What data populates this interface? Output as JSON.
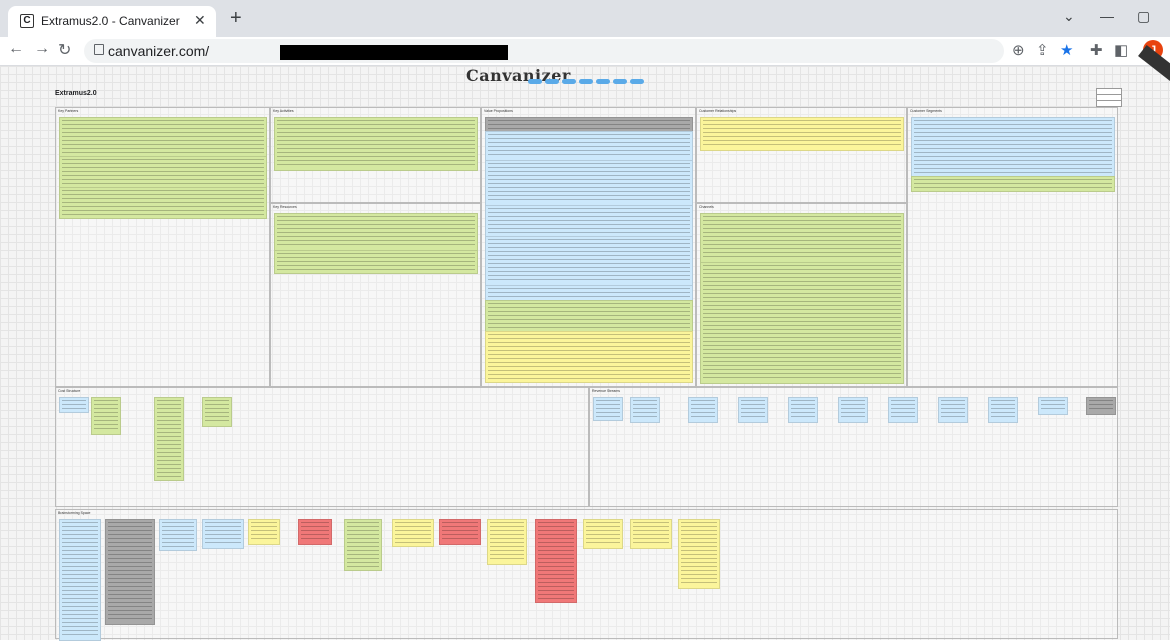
{
  "browser": {
    "tab_title": "Extramus2.0 - Canvanizer",
    "tab_favicon": "C",
    "url": "canvanizer.com/",
    "avatar_letter": "J",
    "accent_color": "#e8430f"
  },
  "canvas": {
    "logo": "Canvanizer",
    "project_title": "Extramus2.0",
    "blocks": [
      "Key Partners",
      "Key Activities",
      "Value Propositions",
      "Customer Relationships",
      "Customer Segments",
      "Key Resources",
      "Channels",
      "Cost Structure",
      "Revenue Streams",
      "Brainstorming Space"
    ],
    "note_colors": {
      "green": "#d4e8a0",
      "blue": "#cce8fb",
      "yellow": "#fbf59b",
      "gray": "#a9a9a9",
      "red": "#f07878"
    }
  }
}
